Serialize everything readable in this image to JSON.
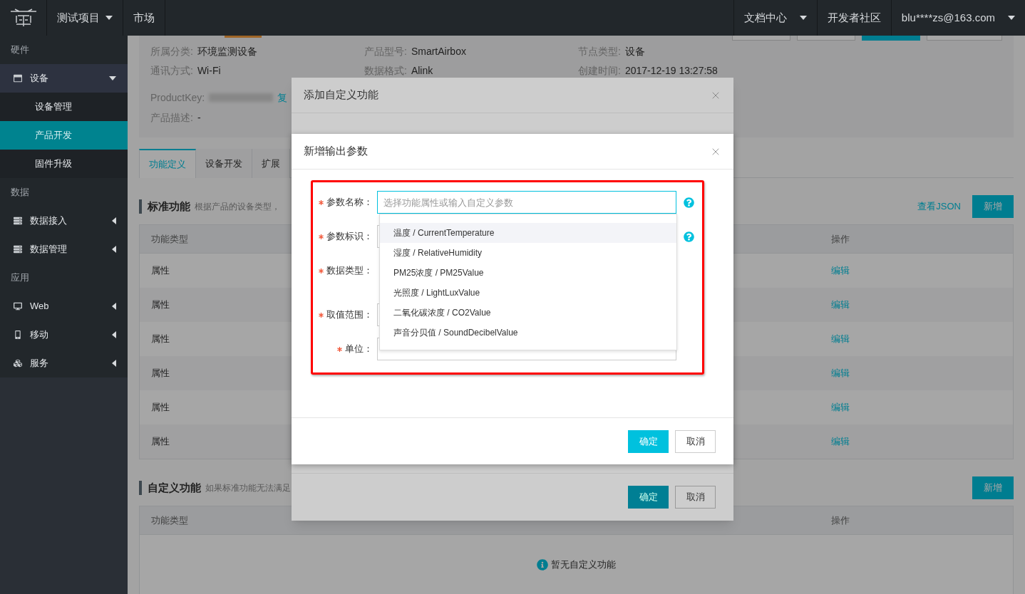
{
  "nav": {
    "menus": [
      {
        "label": "测试项目",
        "dropdown": true
      },
      {
        "label": "市场",
        "dropdown": false
      }
    ],
    "right_menus": [
      {
        "label": "文档中心",
        "dropdown": true
      },
      {
        "label": "开发者社区",
        "dropdown": false
      },
      {
        "label": "blu****zs@163.com",
        "dropdown": true
      }
    ]
  },
  "sidebar": [
    {
      "kind": "section",
      "label": "硬件"
    },
    {
      "kind": "item",
      "label": "设备",
      "expanded": true,
      "children": [
        {
          "label": "设备管理",
          "selected": false
        },
        {
          "label": "产品开发",
          "selected": true
        },
        {
          "label": "固件升级",
          "selected": false
        }
      ]
    },
    {
      "kind": "section",
      "label": "数据"
    },
    {
      "kind": "item",
      "label": "数据接入",
      "expanded": false
    },
    {
      "kind": "item",
      "label": "数据管理",
      "expanded": false
    },
    {
      "kind": "section",
      "label": "应用"
    },
    {
      "kind": "item",
      "label": "Web",
      "expanded": false
    },
    {
      "kind": "item",
      "label": "移动",
      "expanded": false
    },
    {
      "kind": "item",
      "label": "服务",
      "expanded": false
    }
  ],
  "product_info": {
    "header_buttons": [
      {
        "kind": "default"
      },
      {
        "kind": "default"
      },
      {
        "kind": "primary"
      },
      {
        "kind": "default"
      }
    ],
    "product_key": {
      "label": "ProductKey:",
      "masked": true,
      "link": "复"
    },
    "description": {
      "label": "产品描述:",
      "value": "-"
    },
    "columns": [
      [
        {
          "label": "所属分类:",
          "value": "环境监测设备"
        },
        {
          "label": "通讯方式:",
          "value": "Wi-Fi"
        }
      ],
      [
        {
          "label": "产品型号:",
          "value": "SmartAirbox"
        },
        {
          "label": "数据格式:",
          "value": "Alink"
        }
      ],
      [
        {
          "label": "节点类型:",
          "value": "设备"
        },
        {
          "label": "创建时间:",
          "value": "2017-12-19 13:27:58"
        }
      ]
    ]
  },
  "tabs": [
    {
      "label": "功能定义",
      "selected": true
    },
    {
      "label": "设备开发",
      "selected": false
    },
    {
      "label": "扩展",
      "selected": false
    }
  ],
  "standard": {
    "title": "标准功能",
    "description": "根据产品的设备类型，",
    "link": "查看JSON",
    "button": "新增",
    "columns": [
      "功能类型",
      "操作"
    ],
    "rows": [
      {
        "type": "属性",
        "action": "编辑"
      },
      {
        "type": "属性",
        "action": "编辑"
      },
      {
        "type": "属性",
        "action": "编辑"
      },
      {
        "type": "属性",
        "action": "编辑"
      },
      {
        "type": "属性",
        "action": "编辑"
      },
      {
        "type": "属性",
        "action": "编辑"
      }
    ]
  },
  "custom": {
    "title": "自定义功能",
    "description": "如果标准功能无法满足",
    "button": "新增",
    "columns": [
      "功能类型",
      "操作"
    ],
    "empty": "暂无自定义功能"
  },
  "outer_dialog": {
    "title": "添加自定义功能",
    "buttons": [
      {
        "label": "确定",
        "kind": "primary"
      },
      {
        "label": "取消",
        "kind": "default"
      }
    ]
  },
  "inner_dialog": {
    "title": "新增输出参数",
    "fields": [
      {
        "label": "参数名称：",
        "required": true,
        "kind": "combo",
        "placeholder": "选择功能属性或输入自定义参数",
        "help": true
      },
      {
        "label": "参数标识：",
        "required": true,
        "kind": "input",
        "help": true
      },
      {
        "label": "数据类型：",
        "required": true,
        "kind": "none",
        "help": false
      },
      {
        "label": "取值范围：",
        "required": true,
        "kind": "input",
        "help": false
      },
      {
        "label": "单位：",
        "required": true,
        "kind": "select",
        "help": false
      }
    ],
    "options": [
      {
        "label": "温度 / CurrentTemperature",
        "selected": true
      },
      {
        "label": "湿度 / RelativeHumidity",
        "selected": false
      },
      {
        "label": "PM25浓度 / PM25Value",
        "selected": false
      },
      {
        "label": "光照度 / LightLuxValue",
        "selected": false
      },
      {
        "label": "二氧化碳浓度 / CO2Value",
        "selected": false
      },
      {
        "label": "声音分贝值 / SoundDecibelValue",
        "selected": false
      }
    ],
    "buttons": [
      {
        "label": "确定",
        "kind": "primary"
      },
      {
        "label": "取消",
        "kind": "default"
      }
    ]
  }
}
